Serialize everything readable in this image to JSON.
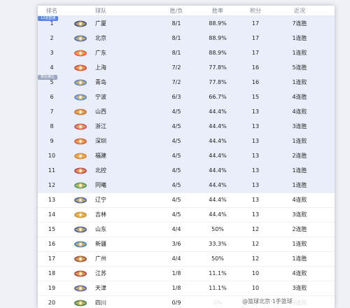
{
  "header": {
    "rank": "排名",
    "team": "球队",
    "wl": "胜/负",
    "pct": "胜率",
    "pts": "积分",
    "streak": "近况"
  },
  "tags": {
    "group_a": "12进直通",
    "group_b": "季后赛区"
  },
  "rows": [
    {
      "rank": "1",
      "team": "广厦",
      "wl": "8/1",
      "pct": "88.9%",
      "pts": "17",
      "streak": "7连胜",
      "logo_color": "#2a3b6e"
    },
    {
      "rank": "2",
      "team": "北京",
      "wl": "8/1",
      "pct": "88.9%",
      "pts": "17",
      "streak": "1连胜",
      "logo_color": "#3a5fa8"
    },
    {
      "rank": "3",
      "team": "广东",
      "wl": "8/1",
      "pct": "88.9%",
      "pts": "17",
      "streak": "1连败",
      "logo_color": "#d9472b"
    },
    {
      "rank": "4",
      "team": "上海",
      "wl": "7/2",
      "pct": "77.8%",
      "pts": "16",
      "streak": "5连胜",
      "logo_color": "#c9342b"
    },
    {
      "rank": "5",
      "team": "青岛",
      "wl": "7/2",
      "pct": "77.8%",
      "pts": "16",
      "streak": "1连败",
      "logo_color": "#4a6fb5"
    },
    {
      "rank": "6",
      "team": "宁波",
      "wl": "6/3",
      "pct": "66.7%",
      "pts": "15",
      "streak": "4连胜",
      "logo_color": "#3d7bd6"
    },
    {
      "rank": "7",
      "team": "山西",
      "wl": "4/5",
      "pct": "44.4%",
      "pts": "13",
      "streak": "4连败",
      "logo_color": "#c0622b"
    },
    {
      "rank": "8",
      "team": "浙江",
      "wl": "4/5",
      "pct": "44.4%",
      "pts": "13",
      "streak": "3连胜",
      "logo_color": "#c33d52"
    },
    {
      "rank": "9",
      "team": "深圳",
      "wl": "4/5",
      "pct": "44.4%",
      "pts": "13",
      "streak": "1连败",
      "logo_color": "#d14a2a"
    },
    {
      "rank": "10",
      "team": "福建",
      "wl": "4/5",
      "pct": "44.4%",
      "pts": "13",
      "streak": "2连胜",
      "logo_color": "#d07a2a"
    },
    {
      "rank": "11",
      "team": "北控",
      "wl": "4/5",
      "pct": "44.4%",
      "pts": "13",
      "streak": "1连胜",
      "logo_color": "#b02f3a"
    },
    {
      "rank": "12",
      "team": "同曦",
      "wl": "4/5",
      "pct": "44.4%",
      "pts": "13",
      "streak": "1连胜",
      "logo_color": "#3b8f5a"
    },
    {
      "rank": "13",
      "team": "辽宁",
      "wl": "4/5",
      "pct": "44.4%",
      "pts": "13",
      "streak": "4连败",
      "logo_color": "#2f4f9a"
    },
    {
      "rank": "14",
      "team": "吉林",
      "wl": "4/5",
      "pct": "44.4%",
      "pts": "13",
      "streak": "3连败",
      "logo_color": "#c5852a"
    },
    {
      "rank": "15",
      "team": "山东",
      "wl": "4/4",
      "pct": "50%",
      "pts": "12",
      "streak": "2连胜",
      "logo_color": "#2d4c8f"
    },
    {
      "rank": "16",
      "team": "新疆",
      "wl": "3/6",
      "pct": "33.3%",
      "pts": "12",
      "streak": "1连败",
      "logo_color": "#2a6fb0"
    },
    {
      "rank": "17",
      "team": "广州",
      "wl": "4/4",
      "pct": "50%",
      "pts": "12",
      "streak": "1连胜",
      "logo_color": "#8a3b2a"
    },
    {
      "rank": "18",
      "team": "江苏",
      "wl": "1/8",
      "pct": "11.1%",
      "pts": "10",
      "streak": "4连败",
      "logo_color": "#a02e2e"
    },
    {
      "rank": "19",
      "team": "天津",
      "wl": "1/8",
      "pct": "11.1%",
      "pts": "10",
      "streak": "3连败",
      "logo_color": "#3a4fa0"
    },
    {
      "rank": "20",
      "team": "四川",
      "wl": "0/9",
      "pct": "0%",
      "pts": "9",
      "streak": "9连败",
      "logo_color": "#2f6d3a"
    }
  ],
  "watermark": "@篮球北京·1手篮球",
  "colors": {
    "highlight_row": "#e9eefa",
    "tag_a": "#5b86e5",
    "tag_b": "#9aa8c4"
  }
}
